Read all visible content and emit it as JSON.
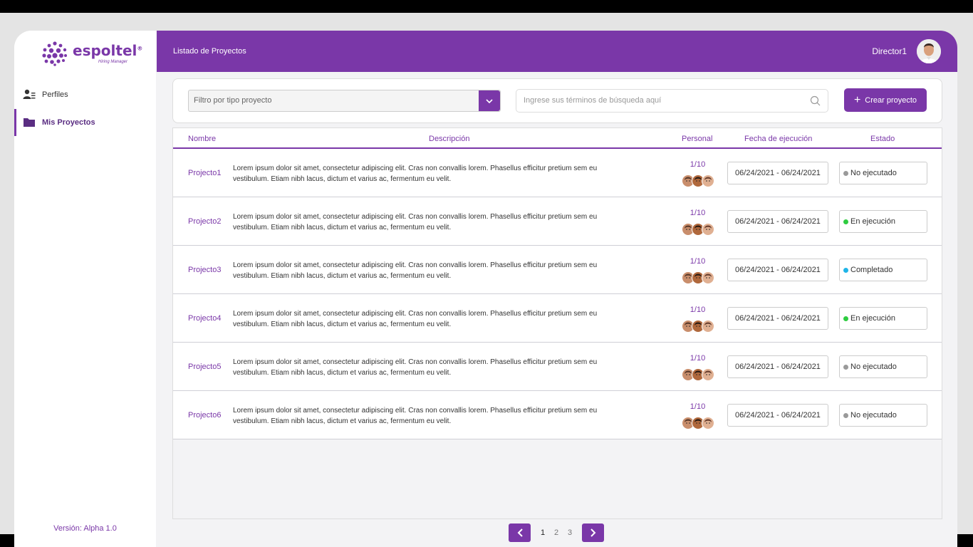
{
  "brand": {
    "name": "espoltel",
    "reg": "®",
    "tagline": "Hiring Manager",
    "color": "#7a37a8"
  },
  "sidebar": {
    "items": [
      {
        "label": "Perfiles",
        "icon": "user-list-icon",
        "active": false
      },
      {
        "label": "Mis Proyectos",
        "icon": "folder-icon",
        "active": true
      }
    ],
    "version": "Versión: Alpha 1.0"
  },
  "header": {
    "title": "Listado de Proyectos",
    "user": "Director1"
  },
  "toolbar": {
    "filter_placeholder": "Filtro por tipo proyecto",
    "search_placeholder": "Ingrese sus términos de búsqueda aquí",
    "create_label": "Crear proyecto"
  },
  "table": {
    "columns": [
      "Nombre",
      "Descripción",
      "Personal",
      "Fecha de ejecución",
      "Estado"
    ],
    "rows": [
      {
        "name": "Projecto1",
        "desc1": "Lorem ipsum dolor sit amet, consectetur adipiscing elit. Cras non  convallis lorem. Phasellus efficitur pretium sem eu",
        "desc2": "vestibulum. Etiam  nibh lacus, dictum et varius ac, fermentum eu velit.",
        "staff": "1/10",
        "date": "06/24/2021 - 06/24/2021",
        "status": "No ejecutado",
        "status_color": "#9a9a9a"
      },
      {
        "name": "Projecto2",
        "desc1": "Lorem ipsum dolor sit amet, consectetur adipiscing elit. Cras non  convallis lorem. Phasellus efficitur pretium sem eu",
        "desc2": "vestibulum. Etiam  nibh lacus, dictum et varius ac, fermentum eu velit.",
        "staff": "1/10",
        "date": "06/24/2021 - 06/24/2021",
        "status": "En ejecución",
        "status_color": "#2ecc40"
      },
      {
        "name": "Projecto3",
        "desc1": "Lorem ipsum dolor sit amet, consectetur adipiscing elit. Cras non  convallis lorem. Phasellus efficitur pretium sem eu",
        "desc2": "vestibulum. Etiam  nibh lacus, dictum et varius ac, fermentum eu velit.",
        "staff": "1/10",
        "date": "06/24/2021 - 06/24/2021",
        "status": "Completado",
        "status_color": "#1fb5e8"
      },
      {
        "name": "Projecto4",
        "desc1": "Lorem ipsum dolor sit amet, consectetur adipiscing elit. Cras non  convallis lorem. Phasellus efficitur pretium sem eu",
        "desc2": "vestibulum. Etiam  nibh lacus, dictum et varius ac, fermentum eu velit.",
        "staff": "1/10",
        "date": "06/24/2021 - 06/24/2021",
        "status": "En ejecución",
        "status_color": "#2ecc40"
      },
      {
        "name": "Projecto5",
        "desc1": "Lorem ipsum dolor sit amet, consectetur adipiscing elit. Cras non  convallis lorem. Phasellus efficitur pretium sem eu",
        "desc2": "vestibulum. Etiam  nibh lacus, dictum et varius ac, fermentum eu velit.",
        "staff": "1/10",
        "date": "06/24/2021 - 06/24/2021",
        "status": "No ejecutado",
        "status_color": "#9a9a9a"
      },
      {
        "name": "Projecto6",
        "desc1": "Lorem ipsum dolor sit amet, consectetur adipiscing elit. Cras non  convallis lorem. Phasellus efficitur pretium sem eu",
        "desc2": "vestibulum. Etiam  nibh lacus, dictum et varius ac, fermentum eu velit.",
        "staff": "1/10",
        "date": "06/24/2021 - 06/24/2021",
        "status": "No ejecutado",
        "status_color": "#9a9a9a"
      }
    ]
  },
  "pagination": {
    "pages": [
      "1",
      "2",
      "3"
    ],
    "current": "1"
  }
}
